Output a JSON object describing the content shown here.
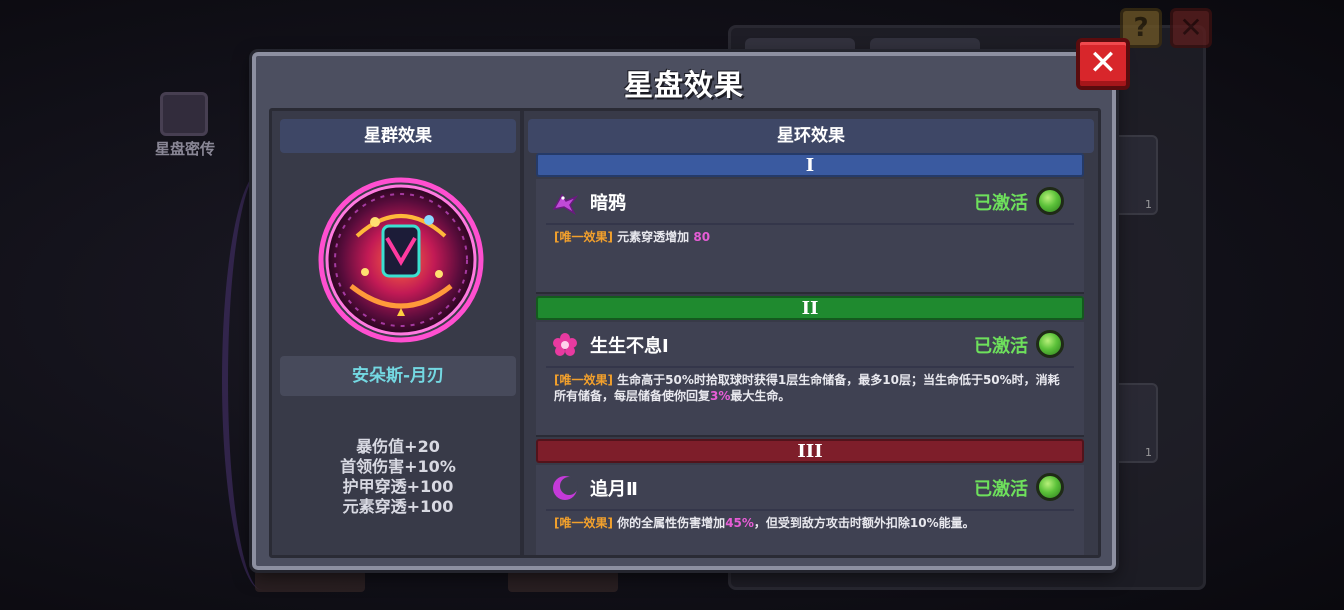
{
  "background": {
    "left_feature_label": "星盘密传",
    "help_icon": "question-icon",
    "close_icon": "close-icon",
    "slot_counts": [
      "1",
      "1"
    ]
  },
  "modal": {
    "title": "星盘效果",
    "close_icon": "close-icon",
    "left": {
      "header": "星群效果",
      "emblem_name": "安朵斯-月刃",
      "stats": [
        "暴伤值+20",
        "首领伤害+10%",
        "护甲穿透+100",
        "元素穿透+100"
      ]
    },
    "right": {
      "header": "星环效果",
      "tiers": [
        {
          "label": "I",
          "color": "#3a5aa0",
          "name": "暗鸦",
          "icon": "crow-icon",
          "status": "已激活",
          "tag": "[唯一效果]",
          "desc_parts": [
            "元素穿透增加 ",
            "80",
            ""
          ]
        },
        {
          "label": "II",
          "color": "#1f8a2f",
          "name": "生生不息Ⅰ",
          "icon": "flower-icon",
          "status": "已激活",
          "tag": "[唯一效果]",
          "desc_parts": [
            "生命高于50%时拾取球时获得1层生命储备，最多10层；当生命低于50%时，消耗所有储备，每层储备使你回复",
            "3%",
            "最大生命。"
          ]
        },
        {
          "label": "III",
          "color": "#7e1e2a",
          "name": "追月Ⅱ",
          "icon": "crescent-icon",
          "status": "已激活",
          "tag": "[唯一效果]",
          "desc_parts": [
            "你的全属性伤害增加",
            "45%",
            "，但受到敌方攻击时额外扣除10%能量。"
          ]
        }
      ]
    }
  },
  "colors": {
    "status_active": "#6ee05c",
    "tag": "#f2a02c",
    "highlight": "#e65dd6",
    "emblem_name": "#74d8e2",
    "close_button": "#d8262b"
  }
}
